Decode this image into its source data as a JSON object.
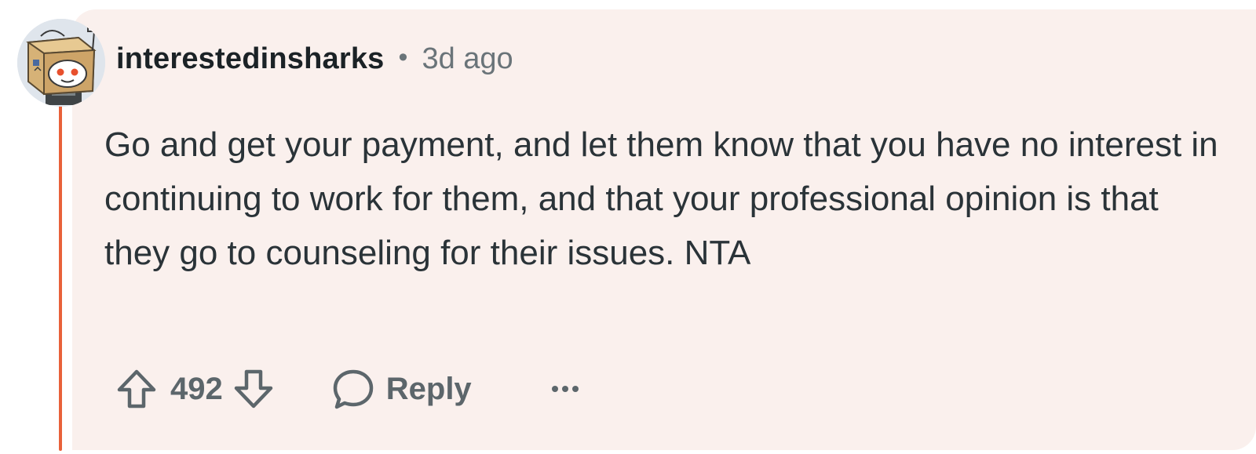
{
  "comment": {
    "author": "interestedinsharks",
    "separator": "•",
    "timestamp": "3d ago",
    "body": "Go and get your payment, and let them know that you have no interest in continuing to work for them, and that your professional opinion is that they go to counseling for their issues. NTA",
    "score": "492",
    "reply_label": "Reply"
  },
  "icons": {
    "upvote": "upvote-arrow-icon",
    "downvote": "downvote-arrow-icon",
    "reply": "speech-bubble-icon",
    "more": "more-horizontal-icon",
    "avatar": "box-robot-avatar"
  },
  "colors": {
    "card_background": "#faf0ed",
    "thread_line": "#e8613a",
    "username": "#1b2226",
    "meta": "#6a7479",
    "body": "#2a3338",
    "action": "#5c666b"
  }
}
